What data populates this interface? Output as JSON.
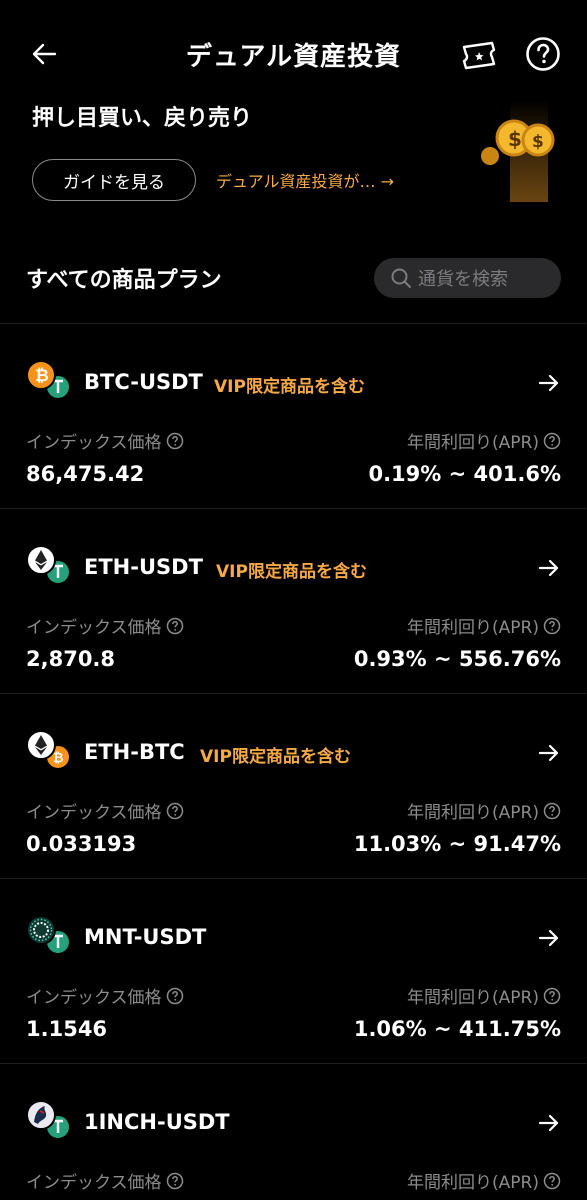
{
  "header": {
    "title": "デュアル資産投資",
    "back_icon": "arrow-left-icon",
    "ticket_icon": "coupon-ticket-icon",
    "help_icon": "question-circle-icon"
  },
  "banner": {
    "headline": "押し目買い、戻り売り",
    "guide_button": "ガイドを見る",
    "link_text": "デュアル資産投資が… →"
  },
  "section": {
    "title": "すべての商品プラン",
    "search_placeholder": "通貨を検索"
  },
  "products": [
    {
      "pair": "BTC-USDT",
      "vip": "VIP限定商品を含む",
      "index_label": "インデックス価格",
      "apr_label": "年間利回り(APR)",
      "index_price": "86,475.42",
      "apr_range": "0.19% ~ 401.6%",
      "base_icon": "btc-icon",
      "quote_icon": "usdt-icon"
    },
    {
      "pair": "ETH-USDT",
      "vip": "VIP限定商品を含む",
      "index_label": "インデックス価格",
      "apr_label": "年間利回り(APR)",
      "index_price": "2,870.8",
      "apr_range": "0.93% ~ 556.76%",
      "base_icon": "eth-icon",
      "quote_icon": "usdt-icon"
    },
    {
      "pair": "ETH-BTC",
      "vip": "VIP限定商品を含む",
      "index_label": "インデックス価格",
      "apr_label": "年間利回り(APR)",
      "index_price": "0.033193",
      "apr_range": "11.03% ~ 91.47%",
      "base_icon": "eth-icon",
      "quote_icon": "btc-icon"
    },
    {
      "pair": "MNT-USDT",
      "vip": "",
      "index_label": "インデックス価格",
      "apr_label": "年間利回り(APR)",
      "index_price": "1.1546",
      "apr_range": "1.06% ~ 411.75%",
      "base_icon": "mnt-icon",
      "quote_icon": "usdt-icon"
    },
    {
      "pair": "1INCH-USDT",
      "vip": "",
      "index_label": "インデックス価格",
      "apr_label": "年間利回り(APR)",
      "index_price": "",
      "apr_range": "",
      "base_icon": "1inch-icon",
      "quote_icon": "usdt-icon"
    }
  ],
  "colors": {
    "background": "#000000",
    "accent_orange": "#f7a945",
    "muted_text": "#8c8c8c",
    "search_bg": "#2a2a2c",
    "btc": "#f7931a",
    "usdt": "#26a17b"
  }
}
